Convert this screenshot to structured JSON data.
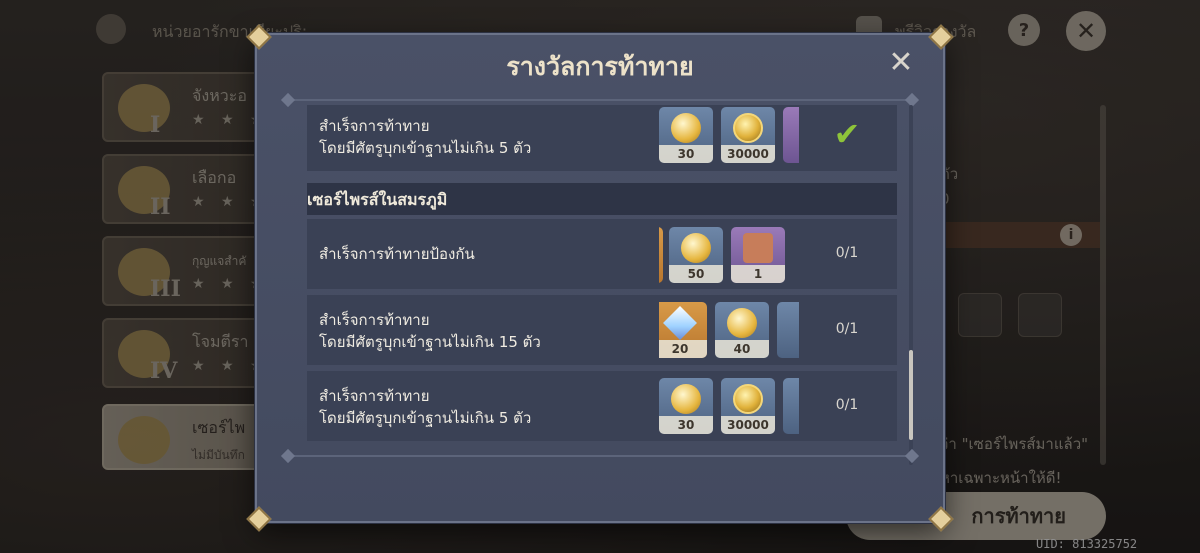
{
  "background": {
    "header_title": "หน่วยอารักขาเซียะปริ:",
    "top_right_label": "พรีวิวรางวัล",
    "help_icon": "?",
    "close_icon": "✕",
    "levels": [
      {
        "roman": "I",
        "name": "จังหวะอ",
        "stars": "★ ★ ★"
      },
      {
        "roman": "II",
        "name": "เลือกอ",
        "stars": "★ ★ ★"
      },
      {
        "roman": "III",
        "name": "กุญแจสำคั",
        "stars": "★ ★ ★"
      },
      {
        "roman": "IV",
        "name": "โจมตีรา",
        "stars": "★ ★ ★"
      },
      {
        "roman": "",
        "name": "เซอร์ไพ",
        "sub": "ไม่มีบันทึก"
      }
    ],
    "right_fragments": [
      "ตัว",
      "0",
      "ว่า \"เซอร์ไพรส์มาแล้ว\"",
      "หาเฉพาะหน้าให้ดี!"
    ],
    "info_icon": "i",
    "challenge_button": "การท้าทาย",
    "uid": "UID: 813325752"
  },
  "modal": {
    "title": "รางวัลการท้าทาย",
    "close_icon": "✕",
    "rows_top": [
      {
        "line1": "สำเร็จการท้าทาย",
        "line2": "โดยมีศัตรูบุกเข้าฐานไม่เกิน 5 ตัว",
        "rewards": [
          {
            "kind": "primogem-icon",
            "qty": "30"
          },
          {
            "kind": "mora-icon",
            "qty": "30000"
          },
          {
            "kind": "partial-icon",
            "qty": ""
          }
        ],
        "status": "✔"
      }
    ],
    "section_title": "เซอร์ไพรส์ในสมรภูมิ",
    "rows_section": [
      {
        "line1": "สำเร็จการท้าทายป้องกัน",
        "line2": "",
        "rewards": [
          {
            "kind": "partial-icon",
            "qty": ""
          },
          {
            "kind": "primogem-icon",
            "qty": "50"
          },
          {
            "kind": "machine-icon",
            "qty": "1"
          }
        ],
        "status": "0/1"
      },
      {
        "line1": "สำเร็จการท้าทาย",
        "line2": "โดยมีศัตรูบุกเข้าฐานไม่เกิน 15 ตัว",
        "rewards": [
          {
            "kind": "star-icon",
            "qty": "20"
          },
          {
            "kind": "primogem-icon",
            "qty": "40"
          },
          {
            "kind": "partial-icon",
            "qty": ""
          }
        ],
        "status": "0/1"
      },
      {
        "line1": "สำเร็จการท้าทาย",
        "line2": "โดยมีศัตรูบุกเข้าฐานไม่เกิน 5 ตัว",
        "rewards": [
          {
            "kind": "primogem-icon",
            "qty": "30"
          },
          {
            "kind": "mora-icon",
            "qty": "30000"
          },
          {
            "kind": "partial-icon",
            "qty": ""
          }
        ],
        "status": "0/1"
      }
    ]
  }
}
